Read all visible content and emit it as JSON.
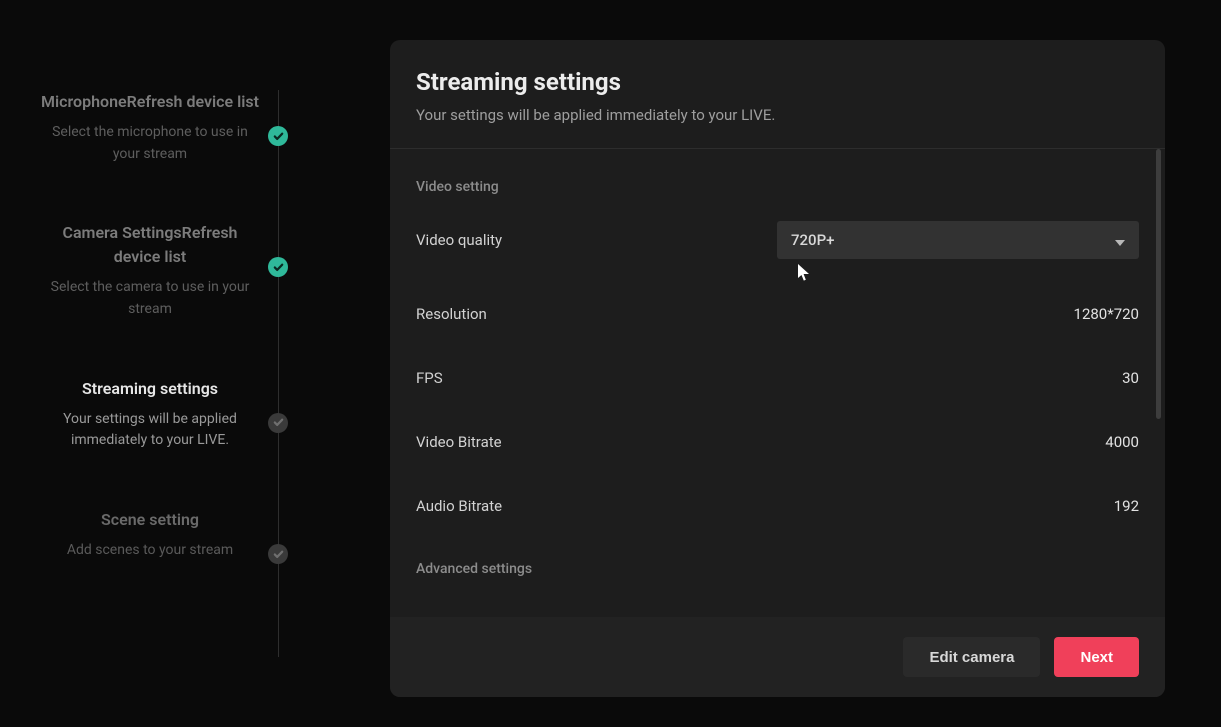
{
  "stepper": {
    "items": [
      {
        "title": "MicrophoneRefresh device list",
        "desc": "Select the microphone to use in your stream"
      },
      {
        "title": "Camera SettingsRefresh device list",
        "desc": "Select the camera to use in your stream"
      },
      {
        "title": "Streaming settings",
        "desc": "Your settings will be applied immediately to your LIVE."
      },
      {
        "title": "Scene setting",
        "desc": "Add scenes to your stream"
      }
    ]
  },
  "panel": {
    "title": "Streaming settings",
    "subtitle": "Your settings will be applied immediately to your LIVE.",
    "section_video": "Video setting",
    "video_quality_label": "Video quality",
    "video_quality_value": "720P+",
    "resolution_label": "Resolution",
    "resolution_value": "1280*720",
    "fps_label": "FPS",
    "fps_value": "30",
    "video_bitrate_label": "Video Bitrate",
    "video_bitrate_value": "4000",
    "audio_bitrate_label": "Audio Bitrate",
    "audio_bitrate_value": "192",
    "section_advanced": "Advanced settings",
    "edit_camera_label": "Edit camera",
    "next_label": "Next"
  }
}
